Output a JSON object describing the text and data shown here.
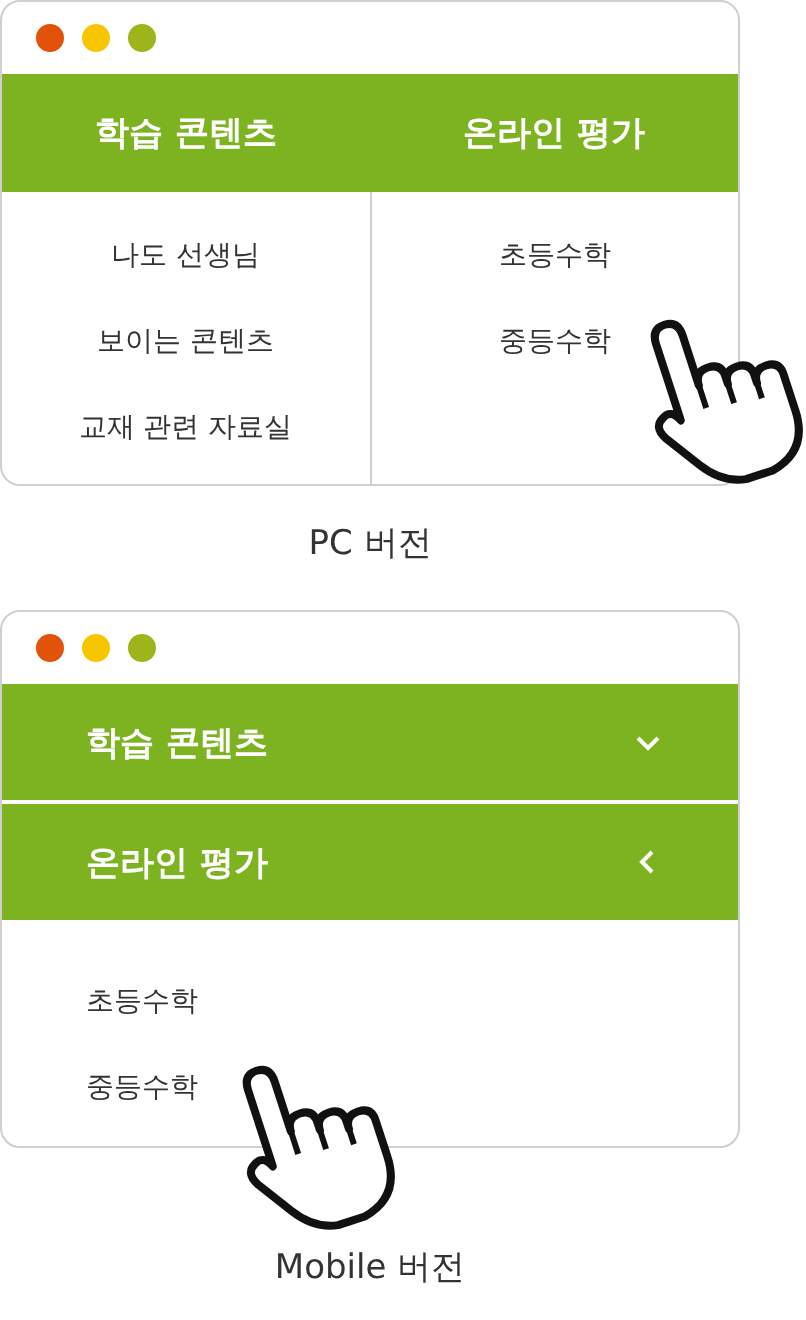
{
  "pc": {
    "menus": [
      {
        "title": "학습 콘텐츠",
        "items": [
          "나도 선생님",
          "보이는 콘텐츠",
          "교재 관련 자료실"
        ]
      },
      {
        "title": "온라인 평가",
        "items": [
          "초등수학",
          "중등수학"
        ]
      }
    ],
    "caption": "PC 버전"
  },
  "mobile": {
    "menus": [
      {
        "title": "학습 콘텐츠",
        "expanded": false
      },
      {
        "title": "온라인 평가",
        "expanded": true,
        "items": [
          "초등수학",
          "중등수학"
        ]
      }
    ],
    "caption": "Mobile 버전"
  }
}
